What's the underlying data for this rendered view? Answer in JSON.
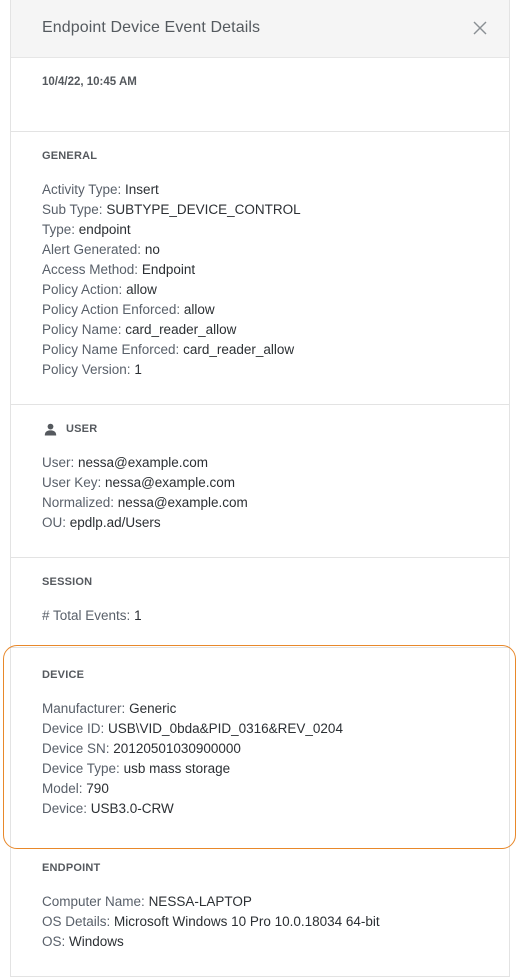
{
  "header": {
    "title": "Endpoint Device Event Details",
    "close_icon": "close-icon"
  },
  "date": "10/4/22, 10:45 AM",
  "general": {
    "title": "GENERAL",
    "rows": [
      {
        "label": "Activity Type:",
        "value": "Insert"
      },
      {
        "label": "Sub Type:",
        "value": "SUBTYPE_DEVICE_CONTROL"
      },
      {
        "label": "Type:",
        "value": "endpoint"
      },
      {
        "label": "Alert Generated:",
        "value": "no"
      },
      {
        "label": "Access Method:",
        "value": "Endpoint"
      },
      {
        "label": "Policy Action:",
        "value": "allow"
      },
      {
        "label": "Policy Action Enforced:",
        "value": "allow"
      },
      {
        "label": "Policy Name:",
        "value": "card_reader_allow"
      },
      {
        "label": "Policy Name Enforced:",
        "value": "card_reader_allow"
      },
      {
        "label": "Policy Version:",
        "value": "1"
      }
    ]
  },
  "user": {
    "title": "USER",
    "icon": "user-icon",
    "rows": [
      {
        "label": "User:",
        "value": "nessa@example.com"
      },
      {
        "label": "User Key:",
        "value": "nessa@example.com"
      },
      {
        "label": "Normalized:",
        "value": "nessa@example.com"
      },
      {
        "label": "OU:",
        "value": "epdlp.ad/Users"
      }
    ]
  },
  "session": {
    "title": "SESSION",
    "rows": [
      {
        "label": "# Total Events:",
        "value": "1"
      }
    ]
  },
  "device": {
    "title": "DEVICE",
    "highlight_color": "#e8882a",
    "rows": [
      {
        "label": "Manufacturer:",
        "value": "Generic"
      },
      {
        "label": "Device ID:",
        "value": "USB\\VID_0bda&PID_0316&REV_0204"
      },
      {
        "label": "Device SN:",
        "value": "20120501030900000"
      },
      {
        "label": "Device Type:",
        "value": "usb mass storage"
      },
      {
        "label": "Model:",
        "value": "790"
      },
      {
        "label": "Device:",
        "value": "USB3.0-CRW"
      }
    ]
  },
  "endpoint": {
    "title": "ENDPOINT",
    "rows": [
      {
        "label": "Computer Name:",
        "value": "NESSA-LAPTOP"
      },
      {
        "label": "OS Details:",
        "value": "Microsoft Windows 10 Pro 10.0.18034 64-bit"
      },
      {
        "label": "OS:",
        "value": "Windows"
      }
    ]
  }
}
